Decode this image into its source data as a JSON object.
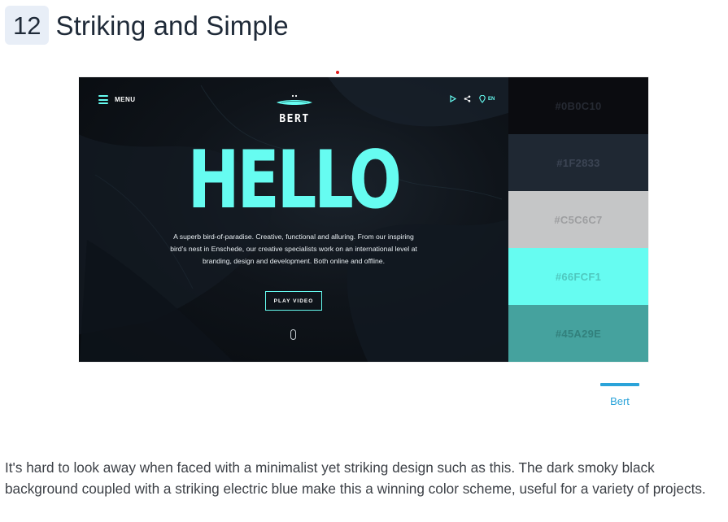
{
  "heading": {
    "number": "12",
    "title": "Striking and Simple"
  },
  "hero": {
    "menu_label": "MENU",
    "brand_name": "BERT",
    "language": "EN",
    "icons": [
      "play-icon",
      "share-icon",
      "location-icon"
    ],
    "headline": "HELLO",
    "description": "A superb bird-of-paradise. Creative, functional and alluring. From our inspiring bird's nest in Enschede, our creative specialists work on an international level at branding, design and development. Both online and offline.",
    "play_button_label": "PLAY VIDEO",
    "background_color": "#0B0C10",
    "accent_color": "#66FCF1"
  },
  "palette": [
    {
      "hex": "#0B0C10",
      "label": "#0B0C10",
      "text_color": "#262a33"
    },
    {
      "hex": "#1F2833",
      "label": "#1F2833",
      "text_color": "#3c4554"
    },
    {
      "hex": "#C5C6C7",
      "label": "#C5C6C7",
      "text_color": "#9d9ea0"
    },
    {
      "hex": "#66FCF1",
      "label": "#66FCF1",
      "text_color": "#4fc8bf"
    },
    {
      "hex": "#45A29E",
      "label": "#45A29E",
      "text_color": "#32807c"
    }
  ],
  "caption": {
    "link_text": "Bert",
    "color": "#2aa3d9"
  },
  "body": {
    "paragraph": "It's hard to look away when faced with a minimalist yet striking design such as this. The dark smoky black background coupled with a striking electric blue make this a winning color scheme, useful for a variety of projects."
  }
}
